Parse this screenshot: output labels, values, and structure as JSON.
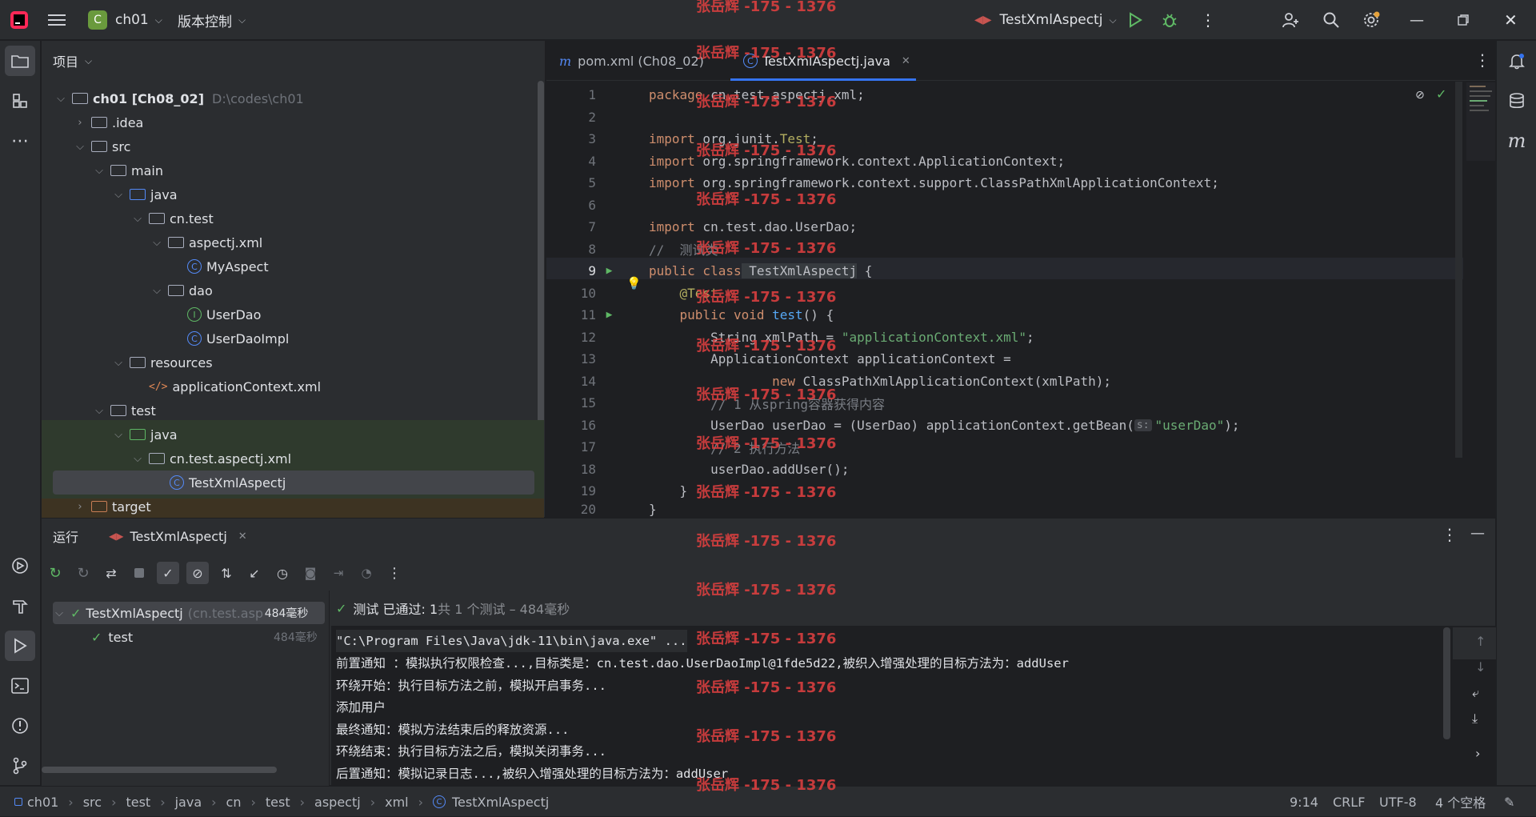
{
  "titlebar": {
    "project_letter": "C",
    "project_name": "ch01",
    "vcs_label": "版本控制",
    "run_config": "TestXmlAspectj"
  },
  "project_panel": {
    "title": "项目",
    "tree": [
      {
        "label": "ch01 [Ch08_02]",
        "path": "D:\\codes\\ch01"
      },
      {
        "label": ".idea"
      },
      {
        "label": "src"
      },
      {
        "label": "main"
      },
      {
        "label": "java"
      },
      {
        "label": "cn.test"
      },
      {
        "label": "aspectj.xml"
      },
      {
        "label": "MyAspect"
      },
      {
        "label": "dao"
      },
      {
        "label": "UserDao"
      },
      {
        "label": "UserDaoImpl"
      },
      {
        "label": "resources"
      },
      {
        "label": "applicationContext.xml"
      },
      {
        "label": "test"
      },
      {
        "label": "java"
      },
      {
        "label": "cn.test.aspectj.xml"
      },
      {
        "label": "TestXmlAspectj"
      },
      {
        "label": "target"
      }
    ]
  },
  "editor": {
    "tabs": [
      {
        "label": "pom.xml (Ch08_02)"
      },
      {
        "label": "TestXmlAspectj.java"
      }
    ],
    "lines": [
      {
        "n": "1"
      },
      {
        "n": "2"
      },
      {
        "n": "3"
      },
      {
        "n": "4"
      },
      {
        "n": "5"
      },
      {
        "n": "6"
      },
      {
        "n": "7"
      },
      {
        "n": "8"
      },
      {
        "n": "9"
      },
      {
        "n": "10"
      },
      {
        "n": "11"
      },
      {
        "n": "12"
      },
      {
        "n": "13"
      },
      {
        "n": "14"
      },
      {
        "n": "15"
      },
      {
        "n": "16"
      },
      {
        "n": "17"
      },
      {
        "n": "18"
      },
      {
        "n": "19"
      },
      {
        "n": "20"
      }
    ],
    "code": {
      "l1a": "package",
      "l1b": " cn.test.aspectj.xml;",
      "l3a": "import",
      "l3b": " org.junit.",
      "l3c": "Test",
      "l3d": ";",
      "l4a": "import",
      "l4b": " org.springframework.context.ApplicationContext;",
      "l5a": "import",
      "l5b": " org.springframework.context.support.ClassPathXmlApplicationContext;",
      "l7a": "import",
      "l7b": " cn.test.dao.UserDao;",
      "l8": "//  测试类",
      "l9a": "public class",
      "l9b": " TestXmlAspectj",
      "l9c": " {",
      "l10": "    @Test",
      "l11a": "    public void",
      "l11b": " test",
      "l11c": "() {",
      "l12a": "        String xmlPath = ",
      "l12b": "\"applicationContext.xml\"",
      "l12c": ";",
      "l13": "        ApplicationContext applicationContext =",
      "l14a": "                new",
      "l14b": " ClassPathXmlApplicationContext(xmlPath);",
      "l15": "        // 1 从spring容器获得内容",
      "l16a": "        UserDao userDao = (UserDao) applicationContext.getBean(",
      "l16hint": "s:",
      "l16b": "\"userDao\"",
      "l16c": ");",
      "l17": "        // 2 执行方法",
      "l18": "        userDao.addUser();",
      "l19": "    }",
      "l20": "}"
    }
  },
  "run_panel": {
    "title": "运行",
    "tab_label": "TestXmlAspectj",
    "tests": [
      {
        "name": "TestXmlAspectj",
        "detail": "(cn.test.asp",
        "time": "484毫秒"
      },
      {
        "name": "test",
        "time": "484毫秒"
      }
    ],
    "summary_a": "测试 已通过: 1",
    "summary_b": "共 1 个测试 – 484毫秒",
    "console": [
      "\"C:\\Program Files\\Java\\jdk-11\\bin\\java.exe\" ...",
      "前置通知 ：模拟执行权限检查...,目标类是：cn.test.dao.UserDaoImpl@1fde5d22,被织入增强处理的目标方法为：addUser",
      "环绕开始：执行目标方法之前，模拟开启事务...",
      "添加用户",
      "最终通知：模拟方法结束后的释放资源...",
      "环绕结束：执行目标方法之后，模拟关闭事务...",
      "后置通知：模拟记录日志...,被织入增强处理的目标方法为：addUser"
    ]
  },
  "statusbar": {
    "crumbs": [
      "ch01",
      "src",
      "test",
      "java",
      "cn",
      "test",
      "aspectj",
      "xml",
      "TestXmlAspectj"
    ],
    "position": "9:14",
    "line_sep": "CRLF",
    "encoding": "UTF-8",
    "indent": "4 个空格"
  },
  "watermark": "张岳辉 -175 - 1376",
  "colors": {
    "accent": "#3574f0",
    "pass": "#5fb865",
    "watermark": "#d93f3f"
  }
}
